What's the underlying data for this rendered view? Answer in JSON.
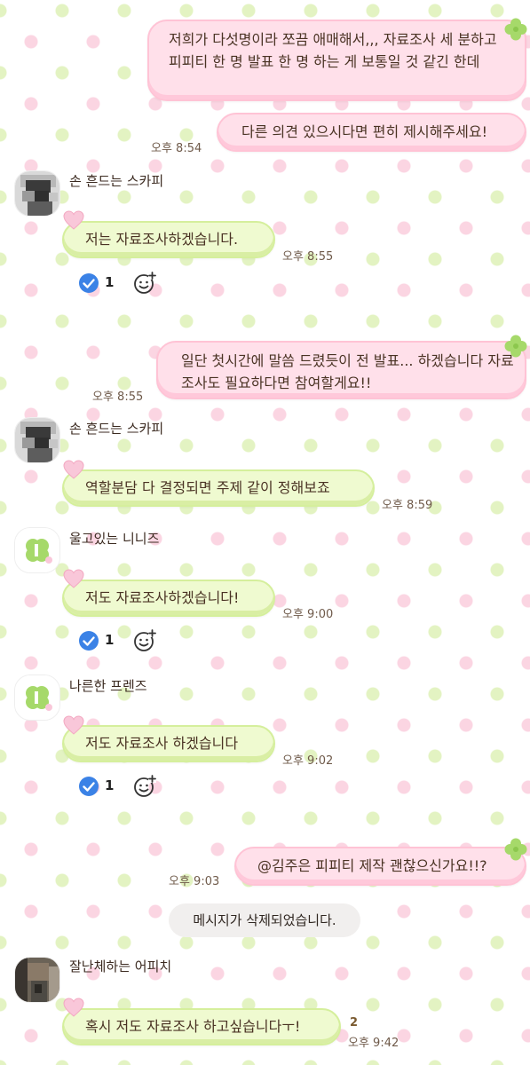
{
  "messages": {
    "m1": {
      "text": "저희가 다섯명이라 쪼끔 애매해서,,, 자료조사 세 분하고 피피티 한 명 발표 한 명 하는 게 보통일 것 같긴 한데"
    },
    "m2": {
      "text": "다른 의견 있으시다면 편히 제시해주세요!",
      "time": "오후 8:54"
    },
    "m3": {
      "sender": "손 흔드는 스카피",
      "text": "저는 자료조사하겠습니다.",
      "time": "오후 8:55",
      "reaction_count": "1"
    },
    "m4": {
      "text": "일단 첫시간에 말씀 드렸듯이 전 발표... 하겠습니다 자료조사도 필요하다면 참여할게요!!",
      "time": "오후 8:55"
    },
    "m5": {
      "sender": "손 흔드는 스카피",
      "text": "역할분담 다 결정되면 주제 같이 정해보죠",
      "time": "오후 8:59"
    },
    "m6": {
      "sender": "울고있는 니니즈",
      "text": "저도 자료조사하겠습니다!",
      "time": "오후 9:00",
      "reaction_count": "1"
    },
    "m7": {
      "sender": "나른한 프렌즈",
      "text": "저도 자료조사 하겠습니다",
      "time": "오후 9:02",
      "reaction_count": "1"
    },
    "m8": {
      "text": "@김주은 피피티 제작 괜찮으신가요!!?",
      "time": "오후 9:03"
    },
    "m9": {
      "system": "메시지가 삭제되었습니다."
    },
    "m10": {
      "sender": "잘난체하는 어피치",
      "text": "혹시 저도 자료조사 하고싶습니다ㅜ!",
      "time": "오후 9:42",
      "unread": "2"
    }
  },
  "colors": {
    "outgoing_bubble": "#ffe0ea",
    "incoming_bubble": "#effad0",
    "check_badge": "#3b82e6",
    "heart": "#f9c3d6",
    "clover": "#a6d96a"
  },
  "icons": [
    "clover-icon",
    "heart-icon",
    "check-circle-icon",
    "emoji-add-icon"
  ]
}
